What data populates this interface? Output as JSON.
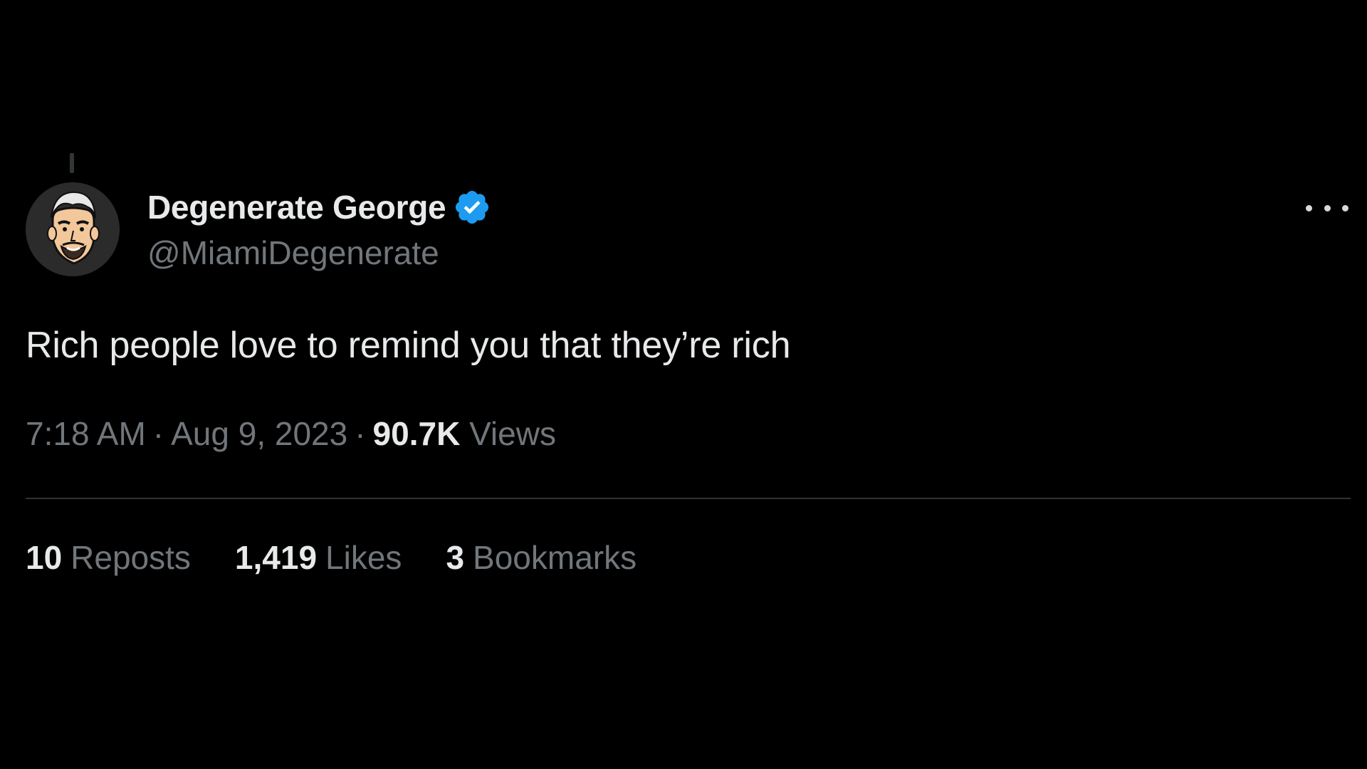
{
  "author": {
    "display_name": "Degenerate George",
    "handle": "@MiamiDegenerate",
    "verified": true,
    "verified_color": "#1d9bf0",
    "avatar_icon": "cartoon-man-avatar"
  },
  "tweet": {
    "text": "Rich people love to remind you that they’re rich",
    "time": "7:18 AM",
    "date": "Aug 9, 2023",
    "views_count": "90.7K",
    "views_label": "Views",
    "separator": "·"
  },
  "stats": {
    "reposts": {
      "count": "10",
      "label": "Reposts"
    },
    "likes": {
      "count": "1,419",
      "label": "Likes"
    },
    "bookmarks": {
      "count": "3",
      "label": "Bookmarks"
    }
  },
  "colors": {
    "background": "#000000",
    "primary_text": "#e7e9ea",
    "secondary_text": "#71767b",
    "divider": "#2f3336"
  },
  "icons": {
    "more": "more-horizontal-icon",
    "verified": "verified-badge-icon"
  }
}
